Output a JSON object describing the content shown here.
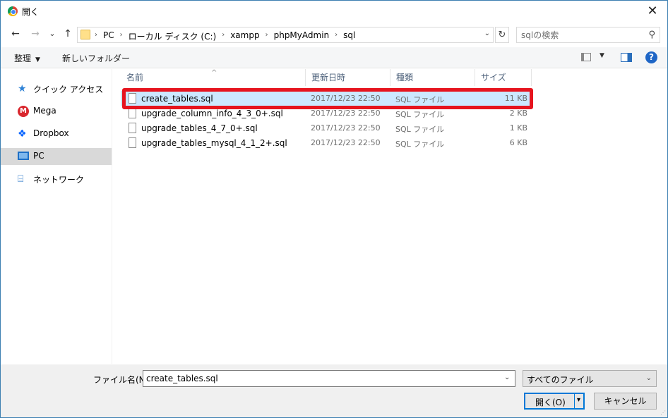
{
  "window": {
    "title": "開く",
    "close_glyph": "✕"
  },
  "nav": {
    "back_glyph": "←",
    "forward_glyph": "→",
    "recent_glyph": "⌄",
    "up_glyph": "↑",
    "breadcrumbs": [
      "PC",
      "ローカル ディスク (C:)",
      "xampp",
      "phpMyAdmin",
      "sql"
    ],
    "crumb_separator": "›",
    "dropdown_glyph": "⌄",
    "refresh_glyph": "↻",
    "search_placeholder": "sqlの検索",
    "search_glyph": "⚲"
  },
  "toolbar": {
    "organize_label": "整理",
    "organize_caret": "▼",
    "new_folder_label": "新しいフォルダー",
    "view_caret": "▼",
    "help_glyph": "?"
  },
  "sidebar": {
    "items": [
      {
        "label": "クイック アクセス",
        "icon": "quick-access-star-icon",
        "glyph": "★"
      },
      {
        "label": "Mega",
        "icon": "mega-icon",
        "glyph": "M"
      },
      {
        "label": "Dropbox",
        "icon": "dropbox-icon",
        "glyph": "❖"
      },
      {
        "label": "PC",
        "icon": "pc-icon",
        "glyph": ""
      },
      {
        "label": "ネットワーク",
        "icon": "network-icon",
        "glyph": "⌸"
      }
    ]
  },
  "columns": {
    "name": "名前",
    "date": "更新日時",
    "type": "種類",
    "size": "サイズ",
    "sort_glyph": "^"
  },
  "files": [
    {
      "name": "create_tables.sql",
      "date": "2017/12/23 22:50",
      "type": "SQL ファイル",
      "size": "11 KB",
      "selected": true
    },
    {
      "name": "upgrade_column_info_4_3_0+.sql",
      "date": "2017/12/23 22:50",
      "type": "SQL ファイル",
      "size": "2 KB",
      "selected": false
    },
    {
      "name": "upgrade_tables_4_7_0+.sql",
      "date": "2017/12/23 22:50",
      "type": "SQL ファイル",
      "size": "1 KB",
      "selected": false
    },
    {
      "name": "upgrade_tables_mysql_4_1_2+.sql",
      "date": "2017/12/23 22:50",
      "type": "SQL ファイル",
      "size": "6 KB",
      "selected": false
    }
  ],
  "bottom": {
    "filename_label": "ファイル名(N):",
    "filename_value": "create_tables.sql",
    "filename_dd_glyph": "⌄",
    "filetype_value": "すべてのファイル",
    "filetype_caret": "⌄",
    "open_label": "開く(O)",
    "open_caret": "▾",
    "cancel_label": "キャンセル"
  },
  "colors": {
    "selection_bg": "#cce8ff",
    "highlight_border": "#e6141e",
    "accent": "#0078d7"
  }
}
